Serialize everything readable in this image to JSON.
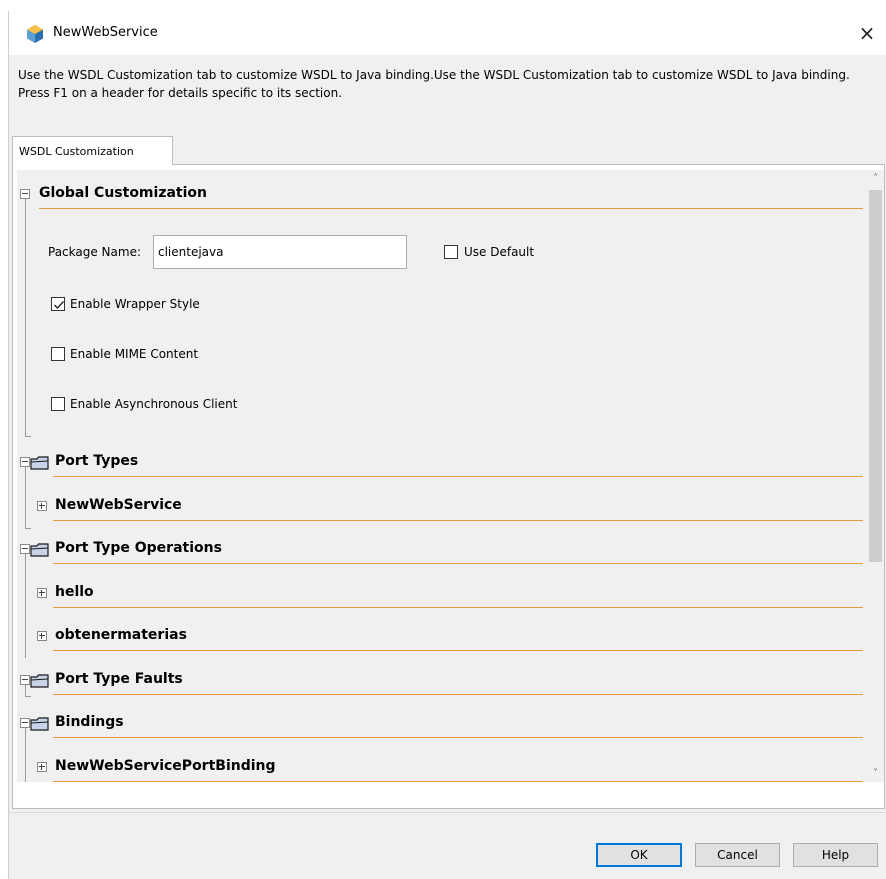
{
  "window": {
    "title": "NewWebService",
    "close_glyph": "×"
  },
  "description": "Use the WSDL Customization tab to customize WSDL to Java binding.Use the WSDL Customization tab to customize WSDL to Java binding. Press F1 on a header for details specific to its section.",
  "tab": {
    "label": "WSDL Customization"
  },
  "global": {
    "header": "Global Customization",
    "package_label": "Package Name:",
    "package_value": "clientejava",
    "use_default_label": "Use Default",
    "use_default_checked": false,
    "options": [
      {
        "label": "Enable Wrapper Style",
        "checked": true
      },
      {
        "label": "Enable MIME Content",
        "checked": false
      },
      {
        "label": "Enable Asynchronous Client",
        "checked": false
      }
    ]
  },
  "sections": {
    "port_types": {
      "header": "Port Types",
      "items": [
        "NewWebService"
      ]
    },
    "port_type_operations": {
      "header": "Port Type Operations",
      "items": [
        "hello",
        "obtenermaterias"
      ]
    },
    "port_type_faults": {
      "header": "Port Type Faults",
      "items": []
    },
    "bindings": {
      "header": "Bindings",
      "items": [
        "NewWebServicePortBinding"
      ]
    }
  },
  "buttons": {
    "ok": "OK",
    "cancel": "Cancel",
    "help": "Help"
  },
  "colors": {
    "underline": "#e59a3c",
    "focus": "#0078d7",
    "dialog_bg": "#f0f0f0"
  },
  "icons": [
    "app-icon",
    "close-icon",
    "folder-icon",
    "tree-expand-icon",
    "tree-collapse-icon",
    "checkmark-icon",
    "scroll-up-icon",
    "scroll-down-icon"
  ]
}
